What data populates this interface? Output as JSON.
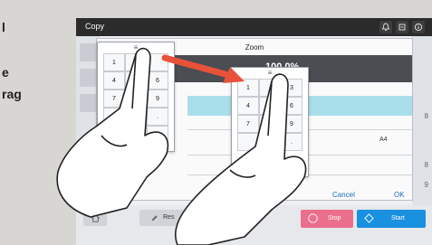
{
  "side_text": {
    "line1": "l",
    "line2": "e",
    "line3": "rag"
  },
  "titlebar": {
    "title": "Copy"
  },
  "dialog": {
    "title": "Zoom",
    "value": "100.0%",
    "paper": "A4",
    "cancel": "Cancel",
    "ok": "OK"
  },
  "keypad1": {
    "keys": [
      "1",
      "",
      "",
      "4",
      "",
      "6",
      "7",
      "",
      "9",
      "",
      "",
      ".",
      "",
      "",
      ""
    ]
  },
  "keypad2": {
    "keys": [
      "1",
      "",
      "3",
      "4",
      "",
      "6",
      "7",
      "",
      "9",
      "",
      "",
      "."
    ]
  },
  "right_strip": {
    "a": "8",
    "b": "8",
    "c": "9"
  },
  "bottombar": {
    "reset": "Res",
    "stop": "Stop",
    "start": "Start"
  },
  "colors": {
    "arrow": "#e8513a",
    "stop": "#ec6e8d",
    "start": "#1a90e0",
    "highlight": "#a9dfea"
  }
}
